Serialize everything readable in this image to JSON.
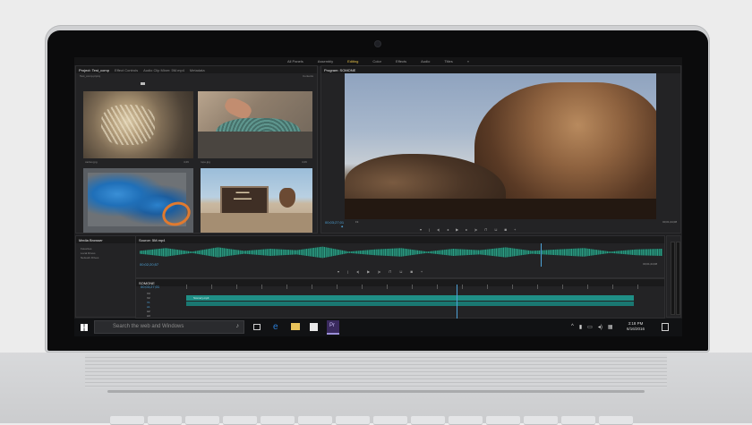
{
  "workspaces": [
    "All Panels",
    "Assembly",
    "Editing",
    "Color",
    "Effects",
    "Audio",
    "Titles"
  ],
  "active_workspace": "Editing",
  "project_panel": {
    "tabs": [
      "Project: Test_comp",
      "Effect Controls",
      "Audio Clip Mixer: 5M.mp4",
      "Metadata"
    ],
    "active_tab": "Project: Test_comp",
    "path": "Test_comp.prproj",
    "item_count": "Contents",
    "items": [
      {
        "name": "cactus.jpg",
        "duration": "4;29"
      },
      {
        "name": "rope.jpg",
        "duration": "4;29"
      },
      {
        "name": "carabiners.jpg",
        "duration": "4;29"
      },
      {
        "name": "sign.jpg",
        "duration": "4;29"
      }
    ]
  },
  "program_monitor": {
    "tab": "Program: SOMONE",
    "timecode": "00;03;27;01",
    "fit": "Fit",
    "duration": "00;01;24;08"
  },
  "media_browser": {
    "tab": "Media Browser",
    "items": [
      "Favorites",
      "Local Drives",
      "Network Drives"
    ]
  },
  "source_panel": {
    "tab": "Source: 5M.mp4",
    "timecode": "00;02;20;57",
    "duration": "00;01;24;08"
  },
  "timeline": {
    "tab": "SOMONE",
    "timecode": "00;03;27;01",
    "clip_label": "Scenery.mp4",
    "tracks": [
      "V3",
      "V2",
      "V1",
      "A1",
      "A2",
      "A3"
    ]
  },
  "taskbar": {
    "search_placeholder": "Search the web and Windows",
    "time": "3:18 PM",
    "date": "6/16/2016"
  },
  "colors": {
    "accent": "#e6c24a",
    "timecode": "#4ea3d8",
    "audio_wave": "#2a8f7a",
    "clip": "#1f8f86"
  }
}
